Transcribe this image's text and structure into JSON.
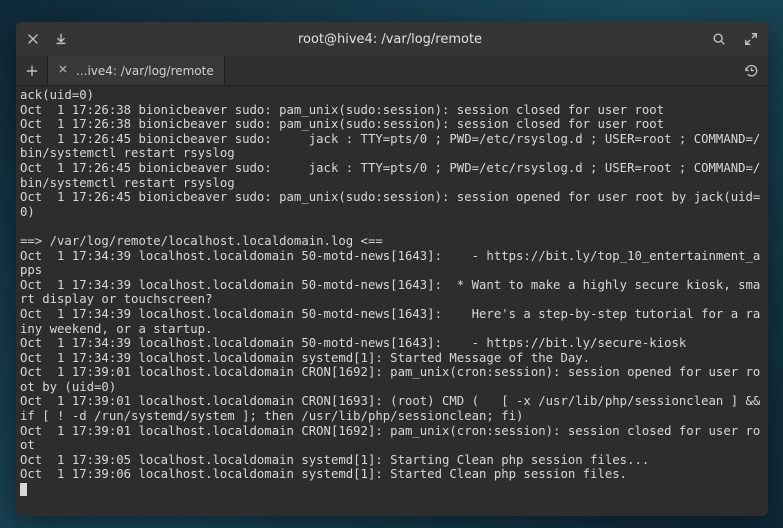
{
  "window": {
    "title": "root@hive4: /var/log/remote"
  },
  "tab": {
    "label": "...ive4: /var/log/remote"
  },
  "icons": {
    "close": "close-icon",
    "download": "download-icon",
    "search": "search-icon",
    "fullscreen": "fullscreen-icon",
    "add": "add-icon",
    "history": "history-icon"
  },
  "terminal": {
    "lines": [
      "ack(uid=0)",
      "Oct  1 17:26:38 bionicbeaver sudo: pam_unix(sudo:session): session closed for user root",
      "Oct  1 17:26:38 bionicbeaver sudo: pam_unix(sudo:session): session closed for user root",
      "Oct  1 17:26:45 bionicbeaver sudo:     jack : TTY=pts/0 ; PWD=/etc/rsyslog.d ; USER=root ; COMMAND=/bin/systemctl restart rsyslog",
      "Oct  1 17:26:45 bionicbeaver sudo:     jack : TTY=pts/0 ; PWD=/etc/rsyslog.d ; USER=root ; COMMAND=/bin/systemctl restart rsyslog",
      "Oct  1 17:26:45 bionicbeaver sudo: pam_unix(sudo:session): session opened for user root by jack(uid=0)",
      "",
      "==> /var/log/remote/localhost.localdomain.log <==",
      "Oct  1 17:34:39 localhost.localdomain 50-motd-news[1643]:    - https://bit.ly/top_10_entertainment_apps",
      "Oct  1 17:34:39 localhost.localdomain 50-motd-news[1643]:  * Want to make a highly secure kiosk, smart display or touchscreen?",
      "Oct  1 17:34:39 localhost.localdomain 50-motd-news[1643]:    Here's a step-by-step tutorial for a rainy weekend, or a startup.",
      "Oct  1 17:34:39 localhost.localdomain 50-motd-news[1643]:    - https://bit.ly/secure-kiosk",
      "Oct  1 17:34:39 localhost.localdomain systemd[1]: Started Message of the Day.",
      "Oct  1 17:39:01 localhost.localdomain CRON[1692]: pam_unix(cron:session): session opened for user root by (uid=0)",
      "Oct  1 17:39:01 localhost.localdomain CRON[1693]: (root) CMD (   [ -x /usr/lib/php/sessionclean ] && if [ ! -d /run/systemd/system ]; then /usr/lib/php/sessionclean; fi)",
      "Oct  1 17:39:01 localhost.localdomain CRON[1692]: pam_unix(cron:session): session closed for user root",
      "Oct  1 17:39:05 localhost.localdomain systemd[1]: Starting Clean php session files...",
      "Oct  1 17:39:06 localhost.localdomain systemd[1]: Started Clean php session files."
    ]
  }
}
